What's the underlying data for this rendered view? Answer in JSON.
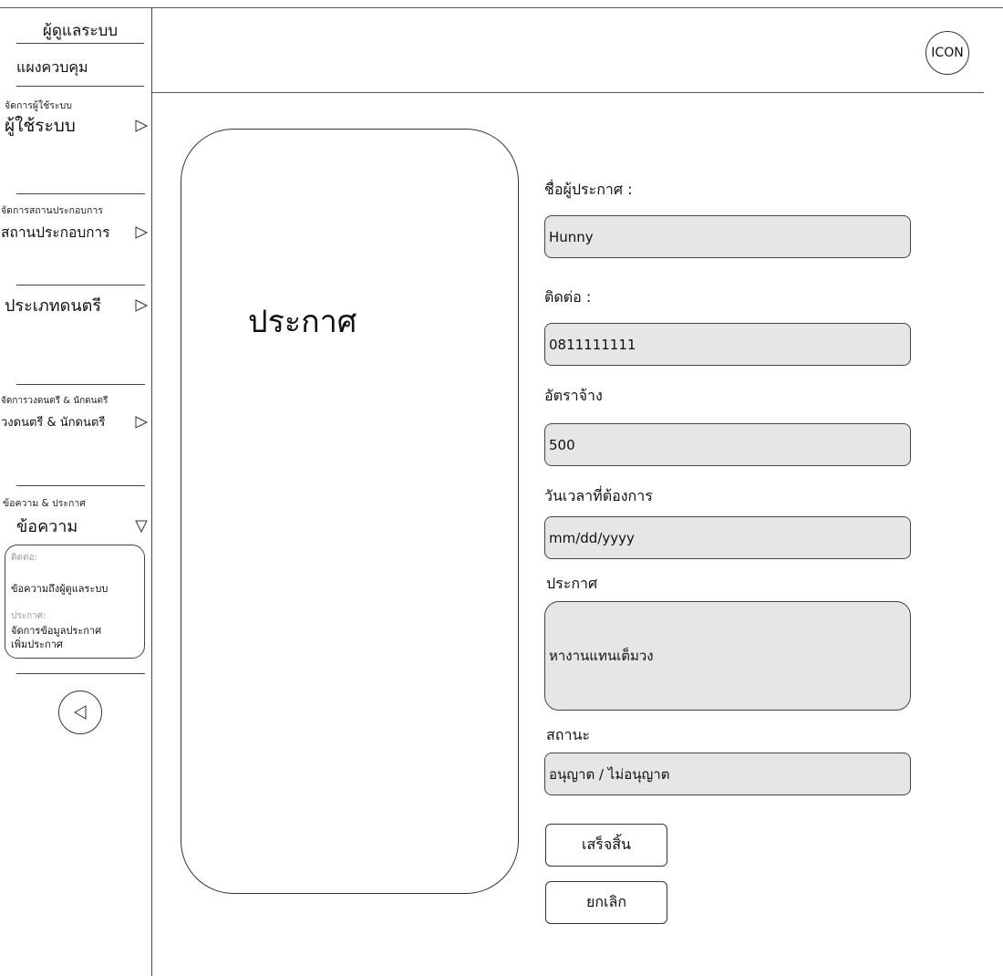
{
  "header": {
    "icon_label": "ICON"
  },
  "sidebar": {
    "title": "ผู้ดูแลระบบ",
    "dashboard": "แผงควบคุม",
    "sections": [
      {
        "caption": "จัดการผู้ใช้ระบบ",
        "label": "ผู้ใช้ระบบ"
      },
      {
        "caption": "จัดการสถานประกอบการ",
        "label": "สถานประกอบการ"
      },
      {
        "caption": "",
        "label": "ประเภทดนตรี"
      },
      {
        "caption": "จัดการวงดนตรี & นักดนตรี",
        "label": "วงดนตรี & นักดนตรี"
      },
      {
        "caption": "ข้อความ & ประกาศ",
        "label": "ข้อความ"
      }
    ],
    "submenu": {
      "contact_caption": "ติดต่อ:",
      "contact_link": "ข้อความถึงผู้ดูแลระบบ",
      "announce_caption": "ประกาศ:",
      "announce_link_1": "จัดการข้อมูลประกาศ",
      "announce_link_2": "เพิ่มประกาศ"
    }
  },
  "poster": {
    "title": "ประกาศ"
  },
  "form": {
    "poster_name_label": "ชื่อผู้ประกาศ :",
    "poster_name_value": "Hunny",
    "contact_label": "ติดต่อ :",
    "contact_value": "0811111111",
    "rate_label": "อัตราจ้าง",
    "rate_value": "500",
    "datetime_label": "วันเวลาที่ต้องการ",
    "datetime_value": "mm/dd/yyyy",
    "announcement_label": "ประกาศ",
    "announcement_value": "หางานแทนเต็มวง",
    "status_label": "สถานะ",
    "status_value": "อนุญาต / ไม่อนุญาต"
  },
  "buttons": {
    "finish": "เสร็จสิ้น",
    "cancel": "ยกเลิก"
  }
}
